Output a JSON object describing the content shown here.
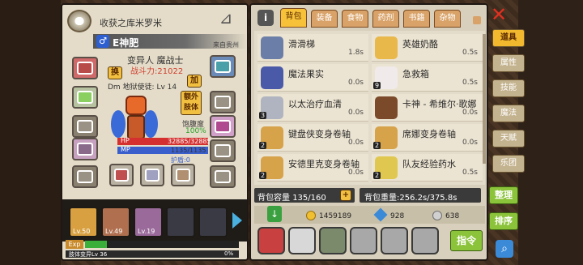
{
  "character": {
    "title": "收获之库米罗米",
    "name": "E神肥",
    "origin": "来自贵州",
    "race_class": "变异人 魔战士",
    "power_label": "战斗力:",
    "power": "21022",
    "level_line": "Dm 地狱使徒: Lv 14",
    "swap_label": "换",
    "add_label": "加",
    "extra_body_label": "额外肢体",
    "satiety_label": "饱腹度",
    "satiety_value": "100%",
    "hp_label": "HP",
    "hp_value": "32885/32885",
    "mp_label": "MP",
    "mp_value": "1135/1135",
    "shield_label": "护盾:0",
    "hp_fraction": 1.0,
    "mp_fraction": 1.0
  },
  "team": [
    {
      "level": "Lv.50"
    },
    {
      "level": "Lv.49"
    },
    {
      "level": "Lv.19"
    }
  ],
  "exp": {
    "label": "Exp",
    "percent_text": "14%",
    "fraction": 0.14,
    "sub": "肢体变异Lv 36",
    "sub_value": "0%"
  },
  "bag": {
    "tabs": [
      "背包",
      "装备",
      "食物",
      "药剂",
      "书籍",
      "杂物"
    ],
    "active_tab": 0,
    "items": [
      {
        "name": "滑滑梯",
        "weight": "1.8s",
        "count": "",
        "color": "#6b7ea8"
      },
      {
        "name": "英雄奶酪",
        "weight": "0.5s",
        "count": "",
        "color": "#e8b84a"
      },
      {
        "name": "魔法果实",
        "weight": "0.0s",
        "count": "",
        "color": "#4a5aa8"
      },
      {
        "name": "急救箱",
        "weight": "0.5s",
        "count": "9",
        "color": "#f0eaea"
      },
      {
        "name": "以太治疗血清",
        "weight": "0.0s",
        "count": "3",
        "color": "#b0b4c0"
      },
      {
        "name": "卡神 - 希维尔·歌娜",
        "weight": "0.0s",
        "count": "",
        "color": "#7a4a2a"
      },
      {
        "name": "键盘侠变身卷轴",
        "weight": "0.0s",
        "count": "2",
        "color": "#d6a24a"
      },
      {
        "name": "席娜变身卷轴",
        "weight": "0.0s",
        "count": "2",
        "color": "#d6a24a"
      },
      {
        "name": "安德里克变身卷轴",
        "weight": "0.0s",
        "count": "2",
        "color": "#d6a24a"
      },
      {
        "name": "队友经验药水",
        "weight": "0.5s",
        "count": "2",
        "color": "#e0c850"
      }
    ],
    "capacity_label": "背包容量",
    "capacity_value": "135/160",
    "weight_label": "背包重量:",
    "weight_value": "256.2s/375.8s",
    "gold": "1459189",
    "gems": "928",
    "silver": "638"
  },
  "side_tabs": [
    "道具",
    "属性",
    "技能",
    "魔法",
    "天赋",
    "乐团"
  ],
  "side_active": 0,
  "actions": {
    "sort": "整理",
    "order": "排序",
    "command": "指令"
  },
  "colors": {
    "accent": "#f2b82e",
    "hp": "#d53030",
    "mp": "#3a5fcc",
    "exp": "#3ab03a",
    "power": "#d04030"
  }
}
